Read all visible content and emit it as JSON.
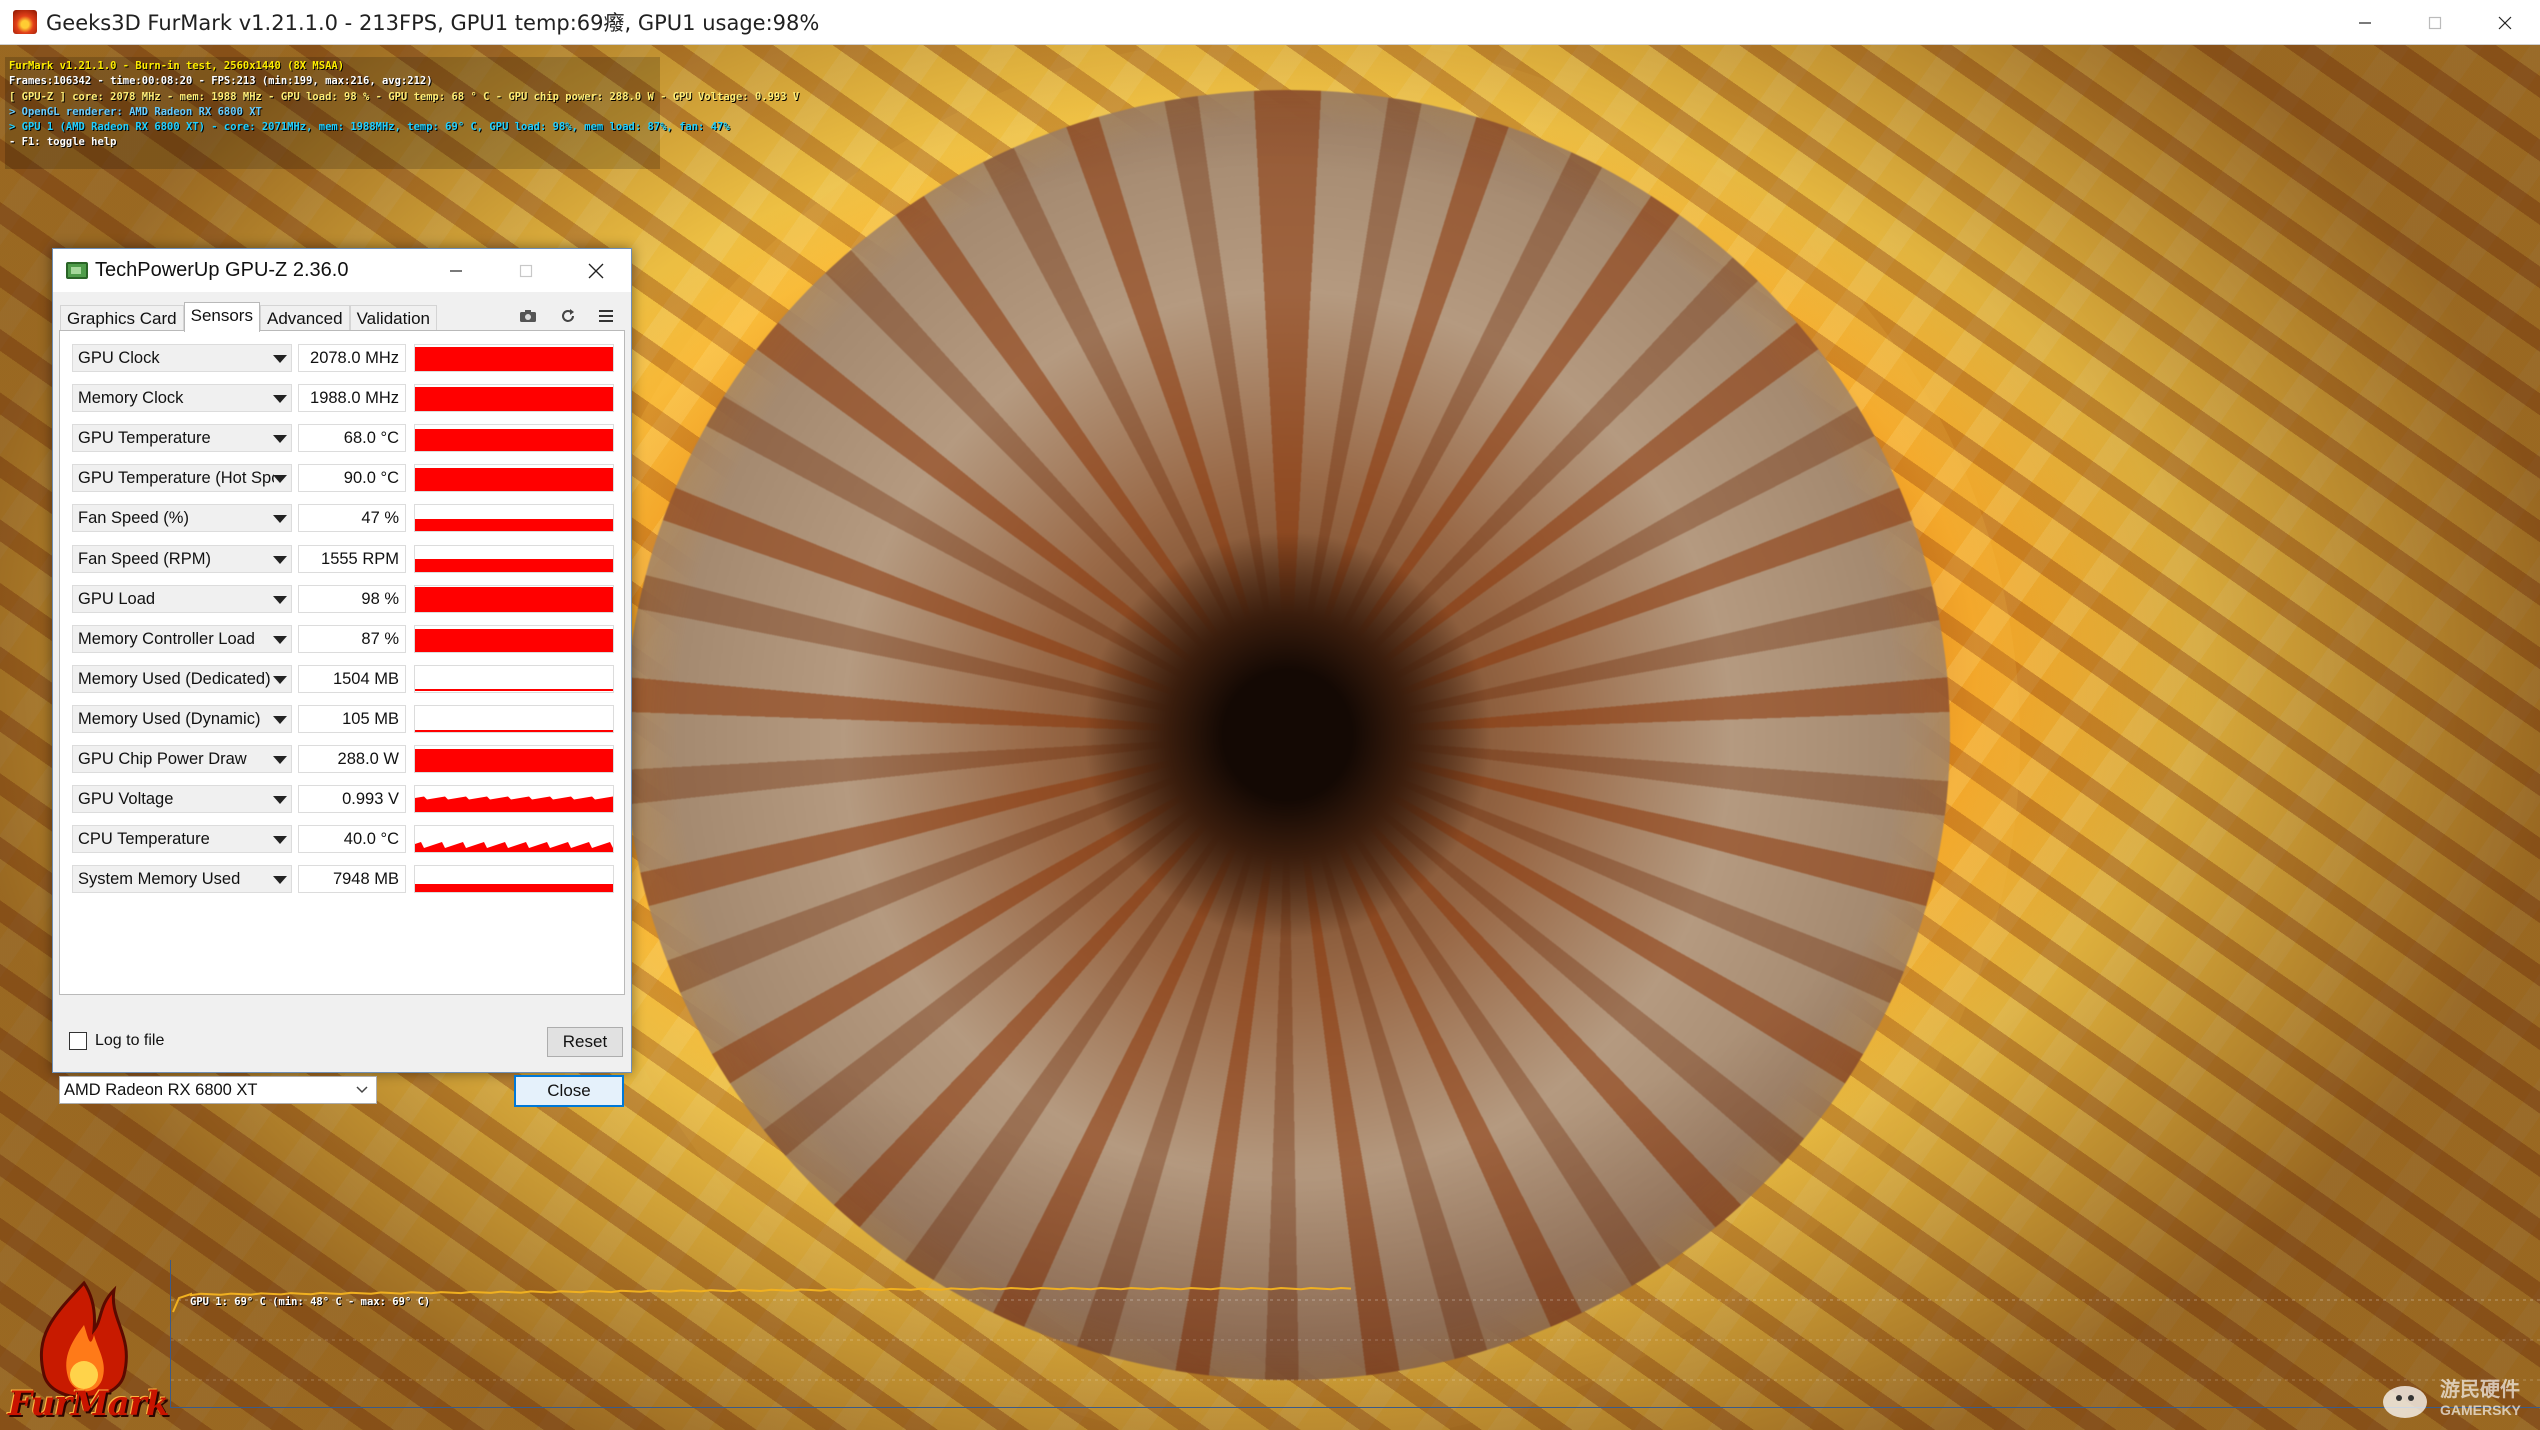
{
  "furmark": {
    "title": "Geeks3D FurMark v1.21.1.0 - 213FPS, GPU1 temp:69癈, GPU1 usage:98%",
    "osd_lines": [
      {
        "text": "FurMark v1.21.1.0 - Burn-in test, 2560x1440 (8X MSAA)",
        "color": "#ffee00"
      },
      {
        "text": "Frames:106342 - time:00:08:20 - FPS:213 (min:199, max:216, avg:212)",
        "color": "#ffffff"
      },
      {
        "text": "[ GPU-Z ] core: 2078 MHz - mem: 1988 MHz - GPU load: 98 % - GPU temp: 68 ° C - GPU chip power: 288.0 W - GPU Voltage: 0.993 V",
        "color": "#ffee77"
      },
      {
        "text": "> OpenGL renderer: AMD Radeon RX 6800 XT",
        "color": "#66ccff"
      },
      {
        "text": "> GPU 1 (AMD Radeon RX 6800 XT) - core: 2071MHz, mem: 1988MHz, temp: 69° C, GPU load: 98%, mem load: 87%, fan: 47%",
        "color": "#22d0ff"
      },
      {
        "text": "- F1: toggle help",
        "color": "#ffffff"
      }
    ],
    "graph_label": "GPU 1: 69° C (min: 48° C - max: 69° C)",
    "logo_text": "FurMark",
    "watermark": [
      "游民硬件",
      "GAMERSKY"
    ]
  },
  "gpuz": {
    "title": "TechPowerUp GPU-Z 2.36.0",
    "tabs": [
      {
        "label": "Graphics Card",
        "active": false
      },
      {
        "label": "Sensors",
        "active": true
      },
      {
        "label": "Advanced",
        "active": false
      },
      {
        "label": "Validation",
        "active": false
      }
    ],
    "toolbar_icons": [
      "camera-icon",
      "refresh-icon",
      "menu-icon"
    ],
    "sensors": [
      {
        "name": "GPU Clock",
        "value": "2078.0 MHz",
        "level": 0.92,
        "style": "solid"
      },
      {
        "name": "Memory Clock",
        "value": "1988.0 MHz",
        "level": 0.92,
        "style": "solid"
      },
      {
        "name": "GPU Temperature",
        "value": "68.0 °C",
        "level": 0.85,
        "style": "solid"
      },
      {
        "name": "GPU Temperature (Hot Spot)",
        "value": "90.0 °C",
        "level": 0.9,
        "style": "solid"
      },
      {
        "name": "Fan Speed (%)",
        "value": "47 %",
        "level": 0.47,
        "style": "solid"
      },
      {
        "name": "Fan Speed (RPM)",
        "value": "1555 RPM",
        "level": 0.5,
        "style": "solid"
      },
      {
        "name": "GPU Load",
        "value": "98 %",
        "level": 0.98,
        "style": "solid"
      },
      {
        "name": "Memory Controller Load",
        "value": "87 %",
        "level": 0.87,
        "style": "solid"
      },
      {
        "name": "Memory Used (Dedicated)",
        "value": "1504 MB",
        "level": 0.1,
        "style": "line"
      },
      {
        "name": "Memory Used (Dynamic)",
        "value": "105 MB",
        "level": 0.02,
        "style": "line"
      },
      {
        "name": "GPU Chip Power Draw",
        "value": "288.0 W",
        "level": 0.9,
        "style": "solid"
      },
      {
        "name": "GPU Voltage",
        "value": "0.993 V",
        "level": 0.55,
        "style": "noisy"
      },
      {
        "name": "CPU Temperature",
        "value": "40.0 °C",
        "level": 0.25,
        "style": "noisy"
      },
      {
        "name": "System Memory Used",
        "value": "7948 MB",
        "level": 0.3,
        "style": "solid"
      }
    ],
    "log_to_file_label": "Log to file",
    "log_to_file_checked": false,
    "reset_label": "Reset",
    "gpu_select": "AMD Radeon RX 6800 XT",
    "close_label": "Close",
    "graph_color": "#ff0000"
  },
  "colors": {
    "osd_graph_line": "#f0b020",
    "gpuz_accent": "#0078d7"
  }
}
